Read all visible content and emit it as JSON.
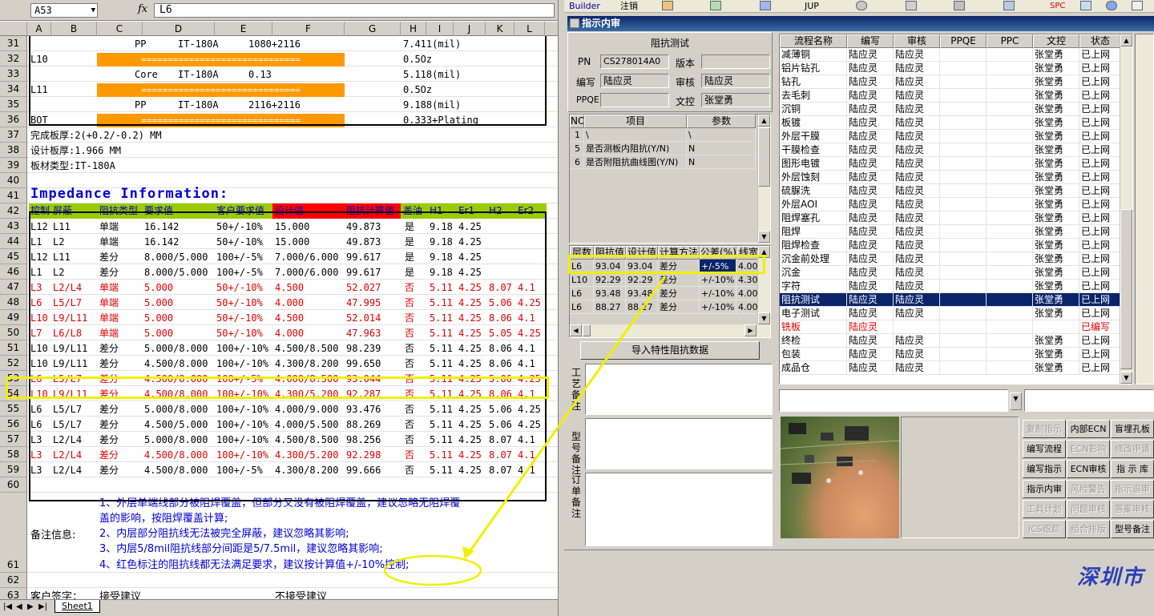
{
  "excel": {
    "namebox": "A53",
    "fx": "fx",
    "formula": "L6",
    "columns": [
      "A",
      "B",
      "C",
      "D",
      "E",
      "F",
      "G",
      "H",
      "I",
      "J",
      "K",
      "L"
    ],
    "stack_rows": [
      {
        "rn": "31",
        "a": "",
        "c": "PP",
        "d": "IT-180A",
        "e": "1080+2116",
        "h": "7.411(mil)",
        "bar": false
      },
      {
        "rn": "32",
        "a": "L10",
        "bar": true,
        "h": "0.5Oz"
      },
      {
        "rn": "33",
        "a": "",
        "c": "Core",
        "d": "IT-180A",
        "e": "0.13",
        "h": "5.118(mil)",
        "bar": false
      },
      {
        "rn": "34",
        "a": "L11",
        "bar": true,
        "h": "0.5Oz"
      },
      {
        "rn": "35",
        "a": "",
        "c": "PP",
        "d": "IT-180A",
        "e": "2116+2116",
        "h": "9.188(mil)",
        "bar": false
      },
      {
        "rn": "36",
        "a": "BOT",
        "bar": true,
        "h": "0.333+Plating"
      }
    ],
    "bar_text": "==============================",
    "info_rows": [
      {
        "rn": "37",
        "text": "完成板厚:2(+0.2/-0.2) MM"
      },
      {
        "rn": "38",
        "text": "设计板厚:1.966 MM"
      },
      {
        "rn": "39",
        "text": "板材类型:IT-180A"
      },
      {
        "rn": "40",
        "text": ""
      },
      {
        "rn": "41",
        "text": "Impedance Information:"
      }
    ],
    "table_header": {
      "rn": "42",
      "cols": [
        "控制",
        "屏蔽",
        "阻抗类型",
        "要求值",
        "客户要求值",
        "设计值",
        "阻抗计算值",
        "盖油",
        "H1",
        "Er1",
        "H2",
        "Er2"
      ]
    },
    "table_rows": [
      {
        "rn": "43",
        "red": false,
        "v": [
          "L12",
          "L11",
          "单端",
          "16.142",
          "50+/-10%",
          "15.000",
          "49.873",
          "是",
          "9.18",
          "4.25",
          "",
          ""
        ]
      },
      {
        "rn": "44",
        "red": false,
        "v": [
          "L1",
          "L2",
          "单端",
          "16.142",
          "50+/-10%",
          "15.000",
          "49.873",
          "是",
          "9.18",
          "4.25",
          "",
          ""
        ]
      },
      {
        "rn": "45",
        "red": false,
        "v": [
          "L12",
          "L11",
          "差分",
          "8.000/5.000",
          "100+/-5%",
          "7.000/6.000",
          "99.617",
          "是",
          "9.18",
          "4.25",
          "",
          ""
        ]
      },
      {
        "rn": "46",
        "red": false,
        "v": [
          "L1",
          "L2",
          "差分",
          "8.000/5.000",
          "100+/-5%",
          "7.000/6.000",
          "99.617",
          "是",
          "9.18",
          "4.25",
          "",
          ""
        ]
      },
      {
        "rn": "47",
        "red": true,
        "v": [
          "L3",
          "L2/L4",
          "单端",
          "5.000",
          "50+/-10%",
          "4.500",
          "52.027",
          "否",
          "5.11",
          "4.25",
          "8.07",
          "4.1"
        ]
      },
      {
        "rn": "48",
        "red": true,
        "v": [
          "L6",
          "L5/L7",
          "单端",
          "5.000",
          "50+/-10%",
          "4.000",
          "47.995",
          "否",
          "5.11",
          "4.25",
          "5.06",
          "4.25"
        ]
      },
      {
        "rn": "49",
        "red": true,
        "v": [
          "L10",
          "L9/L11",
          "单端",
          "5.000",
          "50+/-10%",
          "4.500",
          "52.014",
          "否",
          "5.11",
          "4.25",
          "8.06",
          "4.1"
        ]
      },
      {
        "rn": "50",
        "red": true,
        "v": [
          "L7",
          "L6/L8",
          "单端",
          "5.000",
          "50+/-10%",
          "4.000",
          "47.963",
          "否",
          "5.11",
          "4.25",
          "5.05",
          "4.25"
        ]
      },
      {
        "rn": "51",
        "red": false,
        "v": [
          "L10",
          "L9/L11",
          "差分",
          "5.000/8.000",
          "100+/-10%",
          "4.500/8.500",
          "98.239",
          "否",
          "5.11",
          "4.25",
          "8.06",
          "4.1"
        ]
      },
      {
        "rn": "52",
        "red": false,
        "v": [
          "L10",
          "L9/L11",
          "差分",
          "4.500/8.000",
          "100+/-10%",
          "4.300/8.200",
          "99.650",
          "否",
          "5.11",
          "4.25",
          "8.06",
          "4.1"
        ]
      },
      {
        "rn": "53",
        "red": true,
        "v": [
          "L6",
          "L5/L7",
          "差分",
          "4.500/8.000",
          "100+/-5%",
          "4.000/8.500",
          "93.044",
          "否",
          "5.11",
          "4.25",
          "5.06",
          "4.25"
        ]
      },
      {
        "rn": "54",
        "red": true,
        "v": [
          "L10",
          "L9/L11",
          "差分",
          "4.500/8.000",
          "100+/-10%",
          "4.300/5.200",
          "92.287",
          "否",
          "5.11",
          "4.25",
          "8.06",
          "4.1"
        ]
      },
      {
        "rn": "55",
        "red": false,
        "v": [
          "L6",
          "L5/L7",
          "差分",
          "5.000/8.000",
          "100+/-10%",
          "4.000/9.000",
          "93.476",
          "否",
          "5.11",
          "4.25",
          "5.06",
          "4.25"
        ]
      },
      {
        "rn": "56",
        "red": false,
        "v": [
          "L6",
          "L5/L7",
          "差分",
          "4.500/5.000",
          "100+/-10%",
          "4.000/5.500",
          "88.269",
          "否",
          "5.11",
          "4.25",
          "5.06",
          "4.25"
        ]
      },
      {
        "rn": "57",
        "red": false,
        "v": [
          "L3",
          "L2/L4",
          "差分",
          "5.000/8.000",
          "100+/-10%",
          "4.500/8.500",
          "98.256",
          "否",
          "5.11",
          "4.25",
          "8.07",
          "4.1"
        ]
      },
      {
        "rn": "58",
        "red": true,
        "v": [
          "L3",
          "L2/L4",
          "差分",
          "4.500/8.000",
          "100+/-10%",
          "4.300/5.200",
          "92.298",
          "否",
          "5.11",
          "4.25",
          "8.07",
          "4.1"
        ]
      },
      {
        "rn": "59",
        "red": false,
        "v": [
          "L3",
          "L2/L4",
          "差分",
          "4.500/8.000",
          "100+/-5%",
          "4.300/8.200",
          "99.666",
          "否",
          "5.11",
          "4.25",
          "8.07",
          "4.1"
        ]
      }
    ],
    "rows_after": [
      "60",
      "61",
      "62",
      "63"
    ],
    "notes_label": "备注信息:",
    "notes": [
      "1、外层单端线部分被阻焊覆盖，但部分又没有被阻焊覆盖，建议忽略无阻焊覆",
      "盖的影响，按阻焊覆盖计算;",
      "2、内层部分阻抗线无法被完全屏蔽，建议忽略其影响;",
      "3、内层5/8mil阻抗线部分间距是5/7.5mil，建议忽略其影响;",
      "4、红色标注的阻抗线都无法满足要求，建议按计算值+/-10%控制;"
    ],
    "row63_a": "客户签字：",
    "row63_c": "接受建议",
    "row63_f": "不接受建议",
    "sheet_tab": "Sheet1"
  },
  "app": {
    "toolbar": {
      "builder": "Builder",
      "logout": "注销",
      "jup": "JUP",
      "spc": "SPC"
    },
    "window_title": "指示内审",
    "imp_test_header": "阻抗测试",
    "form": {
      "pn_label": "PN",
      "pn_value": "CS278014A0",
      "version_label": "版本",
      "version_value": "",
      "writer_label": "编写",
      "writer_value": "陆应灵",
      "reviewer_label": "审核",
      "reviewer_value": "陆应灵",
      "ppqe_label": "PPQE",
      "ppqe_value": "",
      "doc_label": "文控",
      "doc_value": "张堂勇"
    },
    "param_grid": {
      "headers": [
        "NO",
        "项目",
        "参数"
      ],
      "rows": [
        {
          "no": "1",
          "item": "\\",
          "param": "\\"
        },
        {
          "no": "5",
          "item": "是否测板内阻抗(Y/N)",
          "param": "N"
        },
        {
          "no": "6",
          "item": "是否附阻抗曲线图(Y/N)",
          "param": "N"
        }
      ]
    },
    "imp_grid": {
      "headers": [
        "层数",
        "阻抗值",
        "设计值",
        "计算方法",
        "公差(%)",
        "线宽"
      ],
      "rows": [
        {
          "v": [
            "L6",
            "93.04",
            "93.04",
            "差分",
            "+/-5%",
            "4.00"
          ],
          "hl": true
        },
        {
          "v": [
            "L10",
            "92.29",
            "92.29",
            "差分",
            "+/-10%",
            "4.30"
          ],
          "hl": false
        },
        {
          "v": [
            "L6",
            "93.48",
            "93.48",
            "差分",
            "+/-10%",
            "4.00"
          ],
          "hl": false
        },
        {
          "v": [
            "L6",
            "88.27",
            "88.27",
            "差分",
            "+/-10%",
            "4.00"
          ],
          "hl": false
        }
      ]
    },
    "import_button": "导入特性阻抗数据",
    "memo_labels": {
      "process": "工艺备注",
      "model": "型号备注",
      "order": "订单备注"
    },
    "flow_grid": {
      "headers": [
        "流程名称",
        "编写",
        "审核",
        "PPQE",
        "PPC",
        "文控",
        "状态"
      ],
      "rows": [
        {
          "v": [
            "减薄铜",
            "陆应灵",
            "陆应灵",
            "",
            "",
            "张堂勇",
            "已上网"
          ],
          "type": "n"
        },
        {
          "v": [
            "铝片钻孔",
            "陆应灵",
            "陆应灵",
            "",
            "",
            "张堂勇",
            "已上网"
          ],
          "type": "n"
        },
        {
          "v": [
            "钻孔",
            "陆应灵",
            "陆应灵",
            "",
            "",
            "张堂勇",
            "已上网"
          ],
          "type": "n"
        },
        {
          "v": [
            "去毛刺",
            "陆应灵",
            "陆应灵",
            "",
            "",
            "张堂勇",
            "已上网"
          ],
          "type": "n"
        },
        {
          "v": [
            "沉铜",
            "陆应灵",
            "陆应灵",
            "",
            "",
            "张堂勇",
            "已上网"
          ],
          "type": "n"
        },
        {
          "v": [
            "板镀",
            "陆应灵",
            "陆应灵",
            "",
            "",
            "张堂勇",
            "已上网"
          ],
          "type": "n"
        },
        {
          "v": [
            "外层干膜",
            "陆应灵",
            "陆应灵",
            "",
            "",
            "张堂勇",
            "已上网"
          ],
          "type": "n"
        },
        {
          "v": [
            "干膜检查",
            "陆应灵",
            "陆应灵",
            "",
            "",
            "张堂勇",
            "已上网"
          ],
          "type": "n"
        },
        {
          "v": [
            "图形电镀",
            "陆应灵",
            "陆应灵",
            "",
            "",
            "张堂勇",
            "已上网"
          ],
          "type": "n"
        },
        {
          "v": [
            "外层蚀刻",
            "陆应灵",
            "陆应灵",
            "",
            "",
            "张堂勇",
            "已上网"
          ],
          "type": "n"
        },
        {
          "v": [
            "硫脲洗",
            "陆应灵",
            "陆应灵",
            "",
            "",
            "张堂勇",
            "已上网"
          ],
          "type": "n"
        },
        {
          "v": [
            "外层AOI",
            "陆应灵",
            "陆应灵",
            "",
            "",
            "张堂勇",
            "已上网"
          ],
          "type": "n"
        },
        {
          "v": [
            "阻焊塞孔",
            "陆应灵",
            "陆应灵",
            "",
            "",
            "张堂勇",
            "已上网"
          ],
          "type": "n"
        },
        {
          "v": [
            "阻焊",
            "陆应灵",
            "陆应灵",
            "",
            "",
            "张堂勇",
            "已上网"
          ],
          "type": "n"
        },
        {
          "v": [
            "阻焊检查",
            "陆应灵",
            "陆应灵",
            "",
            "",
            "张堂勇",
            "已上网"
          ],
          "type": "n"
        },
        {
          "v": [
            "沉金前处理",
            "陆应灵",
            "陆应灵",
            "",
            "",
            "张堂勇",
            "已上网"
          ],
          "type": "n"
        },
        {
          "v": [
            "沉金",
            "陆应灵",
            "陆应灵",
            "",
            "",
            "张堂勇",
            "已上网"
          ],
          "type": "n"
        },
        {
          "v": [
            "字符",
            "陆应灵",
            "陆应灵",
            "",
            "",
            "张堂勇",
            "已上网"
          ],
          "type": "n"
        },
        {
          "v": [
            "阻抗测试",
            "陆应灵",
            "陆应灵",
            "",
            "",
            "张堂勇",
            "已上网"
          ],
          "type": "sel"
        },
        {
          "v": [
            "电子测试",
            "陆应灵",
            "陆应灵",
            "",
            "",
            "张堂勇",
            "已上网"
          ],
          "type": "n"
        },
        {
          "v": [
            "铣板",
            "陆应灵",
            "",
            "",
            "",
            "",
            "已编写"
          ],
          "type": "red"
        },
        {
          "v": [
            "终检",
            "陆应灵",
            "陆应灵",
            "",
            "",
            "张堂勇",
            "已上网"
          ],
          "type": "n"
        },
        {
          "v": [
            "包装",
            "陆应灵",
            "陆应灵",
            "",
            "",
            "张堂勇",
            "已上网"
          ],
          "type": "n"
        },
        {
          "v": [
            "成品仓",
            "陆应灵",
            "陆应灵",
            "",
            "",
            "张堂勇",
            "已上网"
          ],
          "type": "n"
        }
      ]
    },
    "buttons": [
      {
        "label": "复制指示",
        "dis": true
      },
      {
        "label": "内部ECN",
        "dis": false
      },
      {
        "label": "盲埋孔板",
        "dis": false
      },
      {
        "label": "编写流程",
        "dis": false
      },
      {
        "label": "ECN影响",
        "dis": true
      },
      {
        "label": "修改申请",
        "dis": true
      },
      {
        "label": "编写指示",
        "dis": false
      },
      {
        "label": "ECN审核",
        "dis": false
      },
      {
        "label": "指 示 库",
        "dis": false
      },
      {
        "label": "指示内审",
        "dis": false
      },
      {
        "label": "风险警告",
        "dis": true
      },
      {
        "label": "指示退审",
        "dis": true
      },
      {
        "label": "工具计划",
        "dis": true
      },
      {
        "label": "问题审核",
        "dis": true
      },
      {
        "label": "答案审核",
        "dis": true
      },
      {
        "label": "ICS跟踪",
        "dis": true
      },
      {
        "label": "组合排版",
        "dis": true
      },
      {
        "label": "型号备注",
        "dis": false
      }
    ],
    "logo_text": "深圳市"
  },
  "colors": {
    "highlight": "#f0f000",
    "arrow": "#f0f000",
    "orange": "#ff9900",
    "green_header": "#99cc00",
    "red_header": "#ff0000",
    "selected_row": "#0a246a"
  }
}
